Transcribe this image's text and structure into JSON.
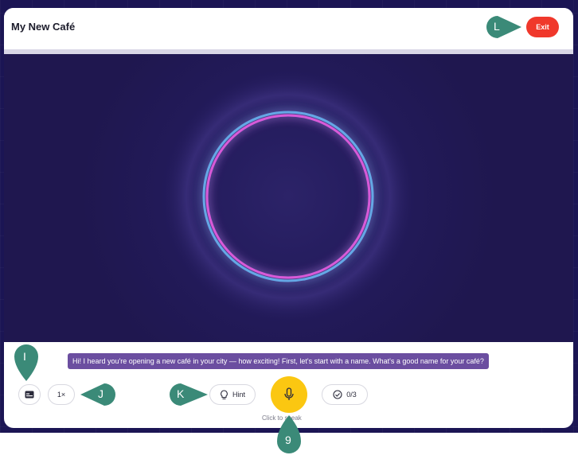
{
  "app": {
    "title": "My New Café",
    "exit_label": "Exit"
  },
  "conversation": {
    "message": "Hi! I heard you're opening a new café in your city — how exciting! First, let's start with a name. What's a good name for your café?"
  },
  "controls": {
    "speed_label": "1×",
    "hint_label": "Hint",
    "progress_label": "0/3",
    "mic_label": "Click to speak"
  },
  "annotations": {
    "L": "L",
    "I": "I",
    "J": "J",
    "K": "K",
    "n9": "9"
  },
  "colors": {
    "exit": "#f0382b",
    "mic": "#fbc711",
    "caption_bg": "#6b4ea0",
    "stage_bg": "#1f174f",
    "ring_outer": "#4fb6e8",
    "ring_inner": "#d85ad8",
    "marker": "#3b8a78"
  },
  "icons": {
    "cc": "closed-captions-icon",
    "hint": "lightbulb-icon",
    "progress": "check-circle-icon",
    "mic": "microphone-icon"
  }
}
